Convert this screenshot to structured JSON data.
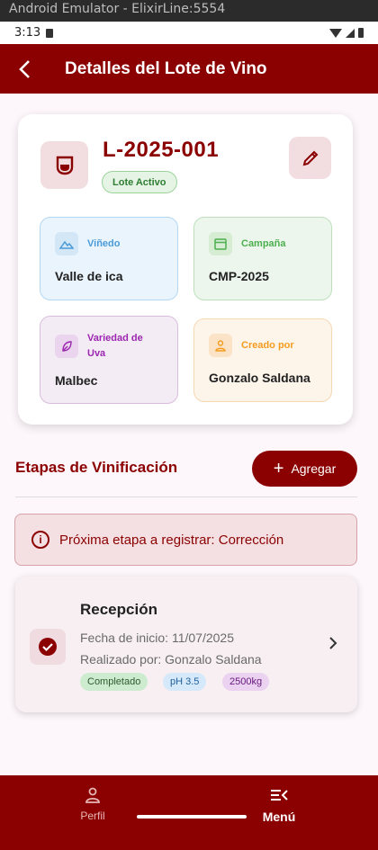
{
  "window_title": "Android Emulator - ElixirLine:5554",
  "status_bar": {
    "time": "3:13"
  },
  "app_bar": {
    "title": "Detalles del Lote de Vino"
  },
  "lot": {
    "code": "L-2025-001",
    "status": "Lote Activo",
    "fields": {
      "vinedo": {
        "label": "Viñedo",
        "value": "Valle de ica"
      },
      "campana": {
        "label": "Campaña",
        "value": "CMP-2025"
      },
      "variedad": {
        "label": "Variedad de Uva",
        "value": "Malbec"
      },
      "creado": {
        "label": "Creado por",
        "value": "Gonzalo Saldana"
      }
    }
  },
  "stages": {
    "title": "Etapas de Vinificación",
    "add_label": "Agregar",
    "next_stage": "Próxima etapa a registrar: Corrección",
    "items": [
      {
        "name": "Recepción",
        "start_date": "Fecha de inicio: 11/07/2025",
        "performed_by": "Realizado por: Gonzalo Saldana",
        "tags": [
          "Completado",
          "pH 3.5",
          "2500kg"
        ]
      }
    ]
  },
  "bottom_nav": {
    "perfil": "Perfil",
    "menu": "Menú"
  },
  "colors": {
    "primary": "#8b0000",
    "background": "#fdf6fa"
  }
}
